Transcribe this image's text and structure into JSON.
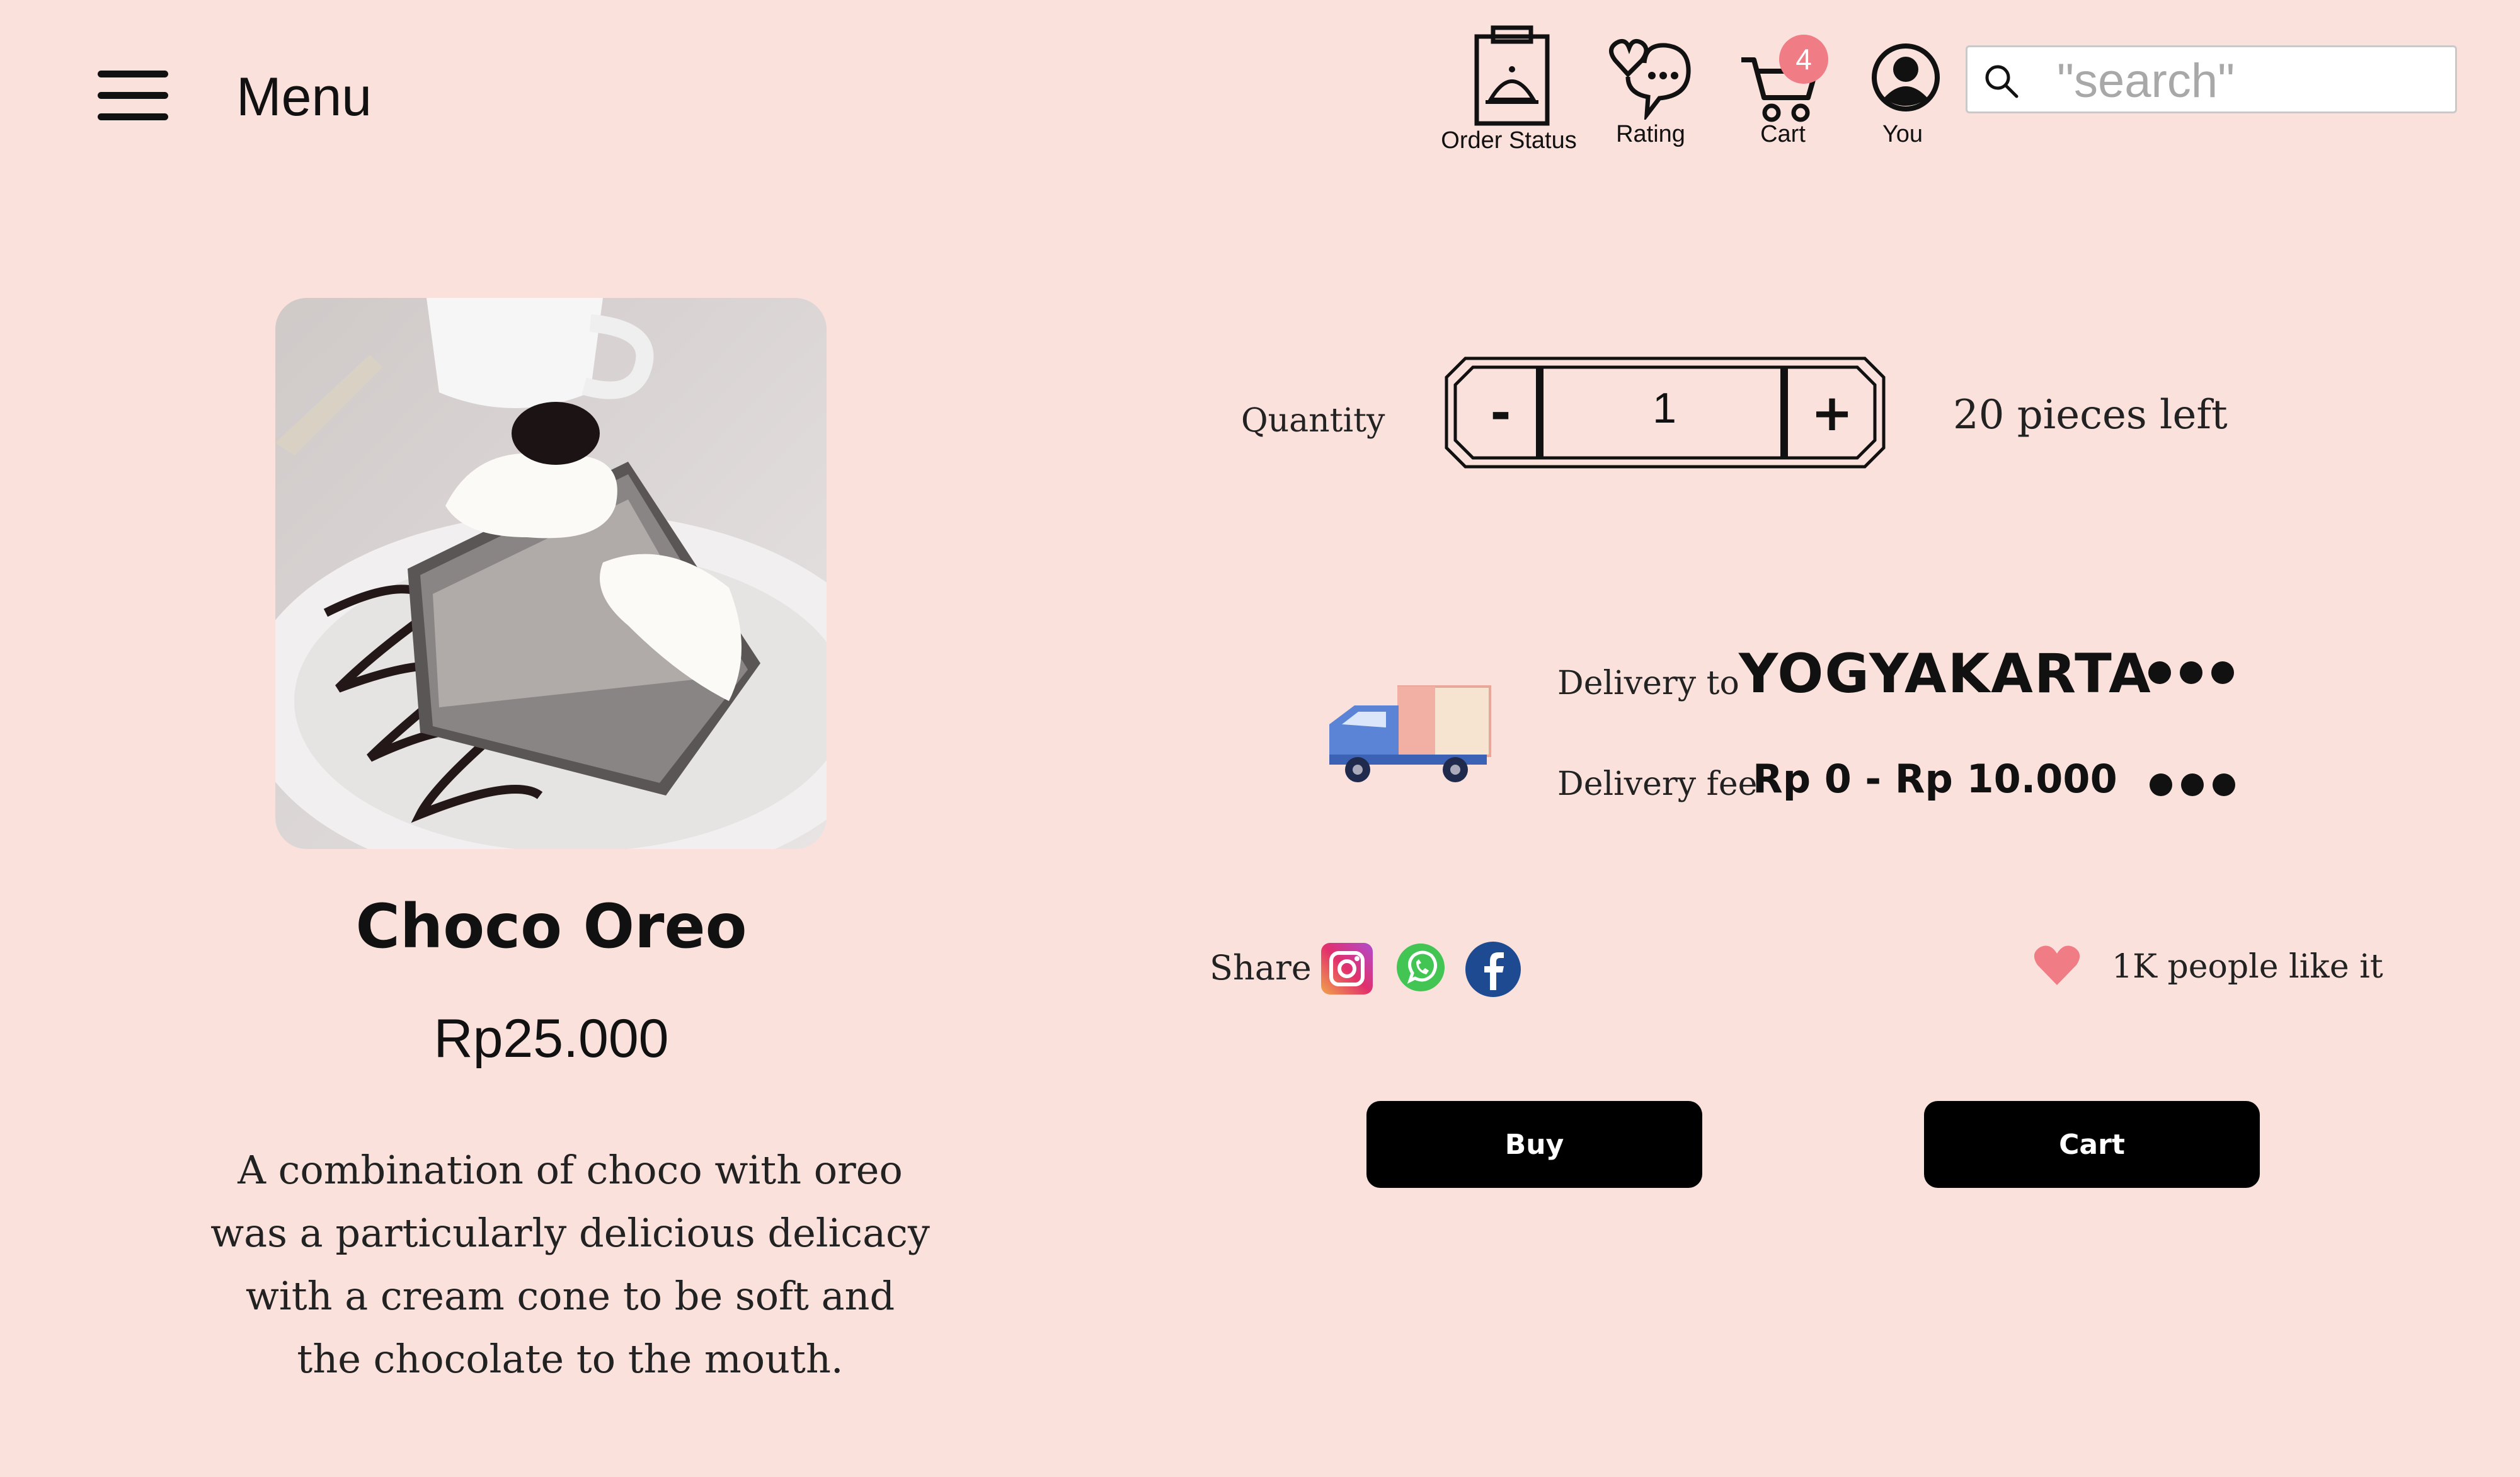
{
  "header": {
    "menu_label": "Menu",
    "nav": {
      "order_status": "Order Status",
      "rating": "Rating",
      "cart": "Cart",
      "you": "You"
    },
    "cart_count": "4",
    "search_placeholder": "\"search\""
  },
  "product": {
    "name": "Choco Oreo",
    "price": "Rp25.000",
    "description": "A combination of choco with oreo was a particularly delicious delicacy with a cream cone to be soft and the chocolate to the mouth."
  },
  "quantity": {
    "label": "Quantity",
    "minus": "-",
    "plus": "+",
    "value": "1",
    "stock": "20 pieces left"
  },
  "delivery": {
    "to_label": "Delivery to",
    "city": "YOGYAKARTA",
    "fee_label": "Delivery fee",
    "fee_value": "Rp 0 - Rp 10.000"
  },
  "share": {
    "label": "Share",
    "likes": "1K people like it"
  },
  "actions": {
    "buy": "Buy",
    "cart": "Cart"
  },
  "colors": {
    "background": "#fae1dc",
    "badge": "#f07c86",
    "button": "#000000",
    "heart": "#f07c86"
  }
}
